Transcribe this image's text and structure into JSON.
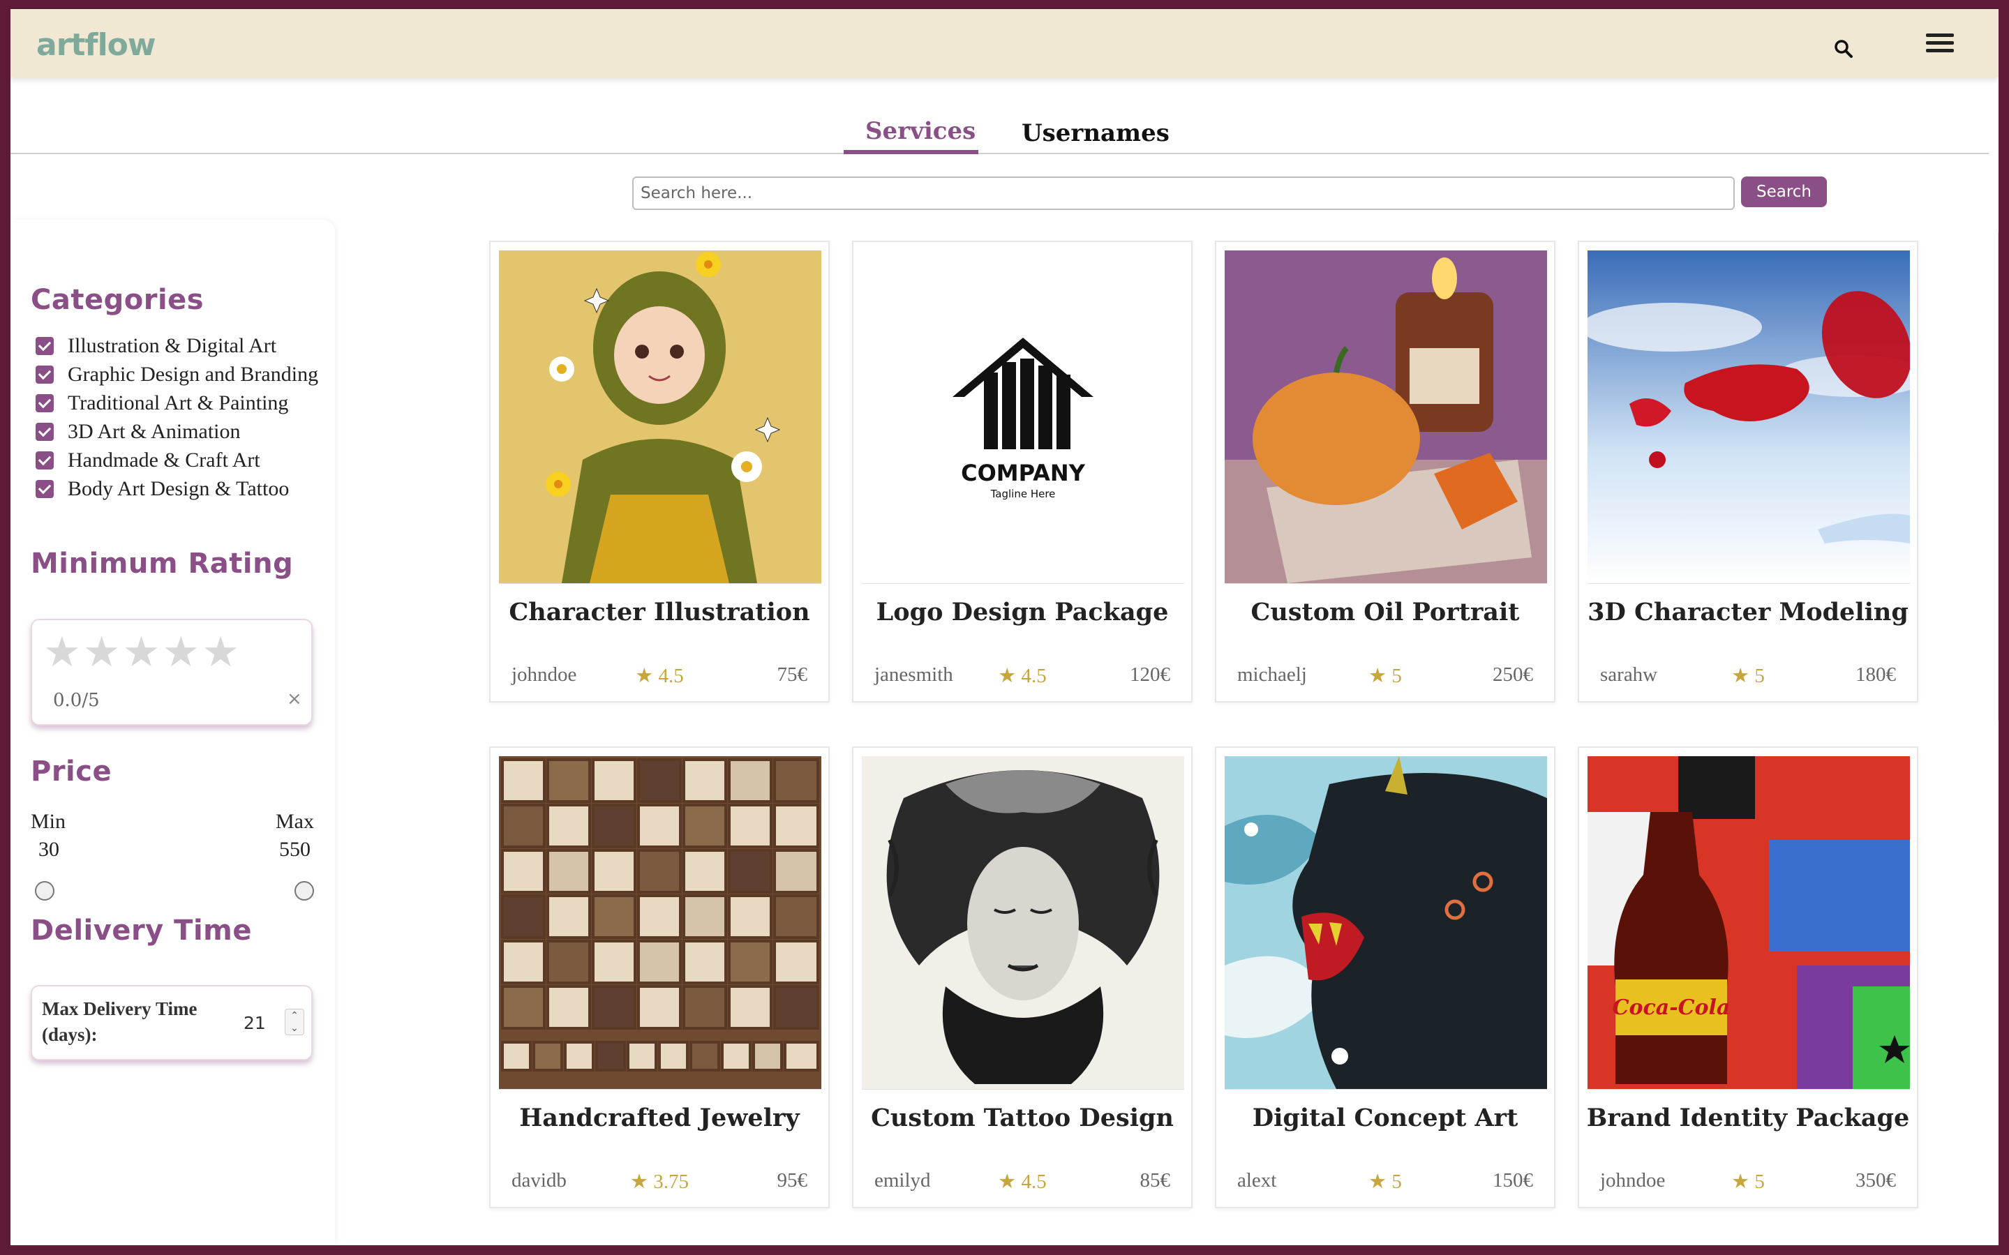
{
  "header": {
    "logo": "artflow",
    "search_icon": "search-icon",
    "menu_icon": "hamburger-menu-icon"
  },
  "tabs": [
    {
      "label": "Services",
      "active": true
    },
    {
      "label": "Usernames",
      "active": false
    }
  ],
  "search": {
    "placeholder": "Search here...",
    "button_label": "Search"
  },
  "sidebar": {
    "categories_title": "Categories",
    "categories": [
      {
        "label": "Illustration & Digital Art",
        "checked": true
      },
      {
        "label": "Graphic Design and Branding",
        "checked": true
      },
      {
        "label": "Traditional Art & Painting",
        "checked": true
      },
      {
        "label": "3D Art & Animation",
        "checked": true
      },
      {
        "label": "Handmade & Craft Art",
        "checked": true
      },
      {
        "label": "Body Art Design & Tattoo",
        "checked": true
      }
    ],
    "rating_title": "Minimum Rating",
    "rating": {
      "value_text": "0.0/5",
      "clear": "×",
      "stars": [
        "★",
        "★",
        "★",
        "★",
        "★"
      ]
    },
    "price_title": "Price",
    "price": {
      "min_label": "Min",
      "max_label": "Max",
      "min_value": "30",
      "max_value": "550"
    },
    "delivery_title": "Delivery Time",
    "delivery": {
      "label": "Max Delivery Time (days):",
      "value": "21",
      "spin_up": "⌃",
      "spin_down": "⌄"
    }
  },
  "services": [
    {
      "title": "Character Illustration",
      "user": "johndoe",
      "rating": "★ 4.5",
      "price": "75€",
      "image": "girl-illustration"
    },
    {
      "title": "Logo Design Package",
      "user": "janesmith",
      "rating": "★ 4.5",
      "price": "120€",
      "image": "company-logo",
      "logo_text": "COMPANY",
      "logo_tagline": "Tagline Here"
    },
    {
      "title": "Custom Oil Portrait",
      "user": "michaelj",
      "rating": "★ 5",
      "price": "250€",
      "image": "pumpkin-painting"
    },
    {
      "title": "3D Character Modeling",
      "user": "sarahw",
      "rating": "★ 5",
      "price": "180€",
      "image": "wine-glass-splash"
    },
    {
      "title": "Handcrafted Jewelry",
      "user": "davidb",
      "rating": "★ 3.75",
      "price": "95€",
      "image": "soap-blocks"
    },
    {
      "title": "Custom Tattoo Design",
      "user": "emilyd",
      "rating": "★ 4.5",
      "price": "85€",
      "image": "tattoo-face"
    },
    {
      "title": "Digital Concept Art",
      "user": "alext",
      "rating": "★ 5",
      "price": "150€",
      "image": "demon-concept"
    },
    {
      "title": "Brand Identity Package",
      "user": "johndoe",
      "rating": "★ 5",
      "price": "350€",
      "image": "cola-bottle-art",
      "bottle_text": "Coca-Cola"
    }
  ],
  "colors": {
    "frame": "#5e1b38",
    "header_bg": "#f0e8d2",
    "accent": "#8a4f86",
    "logo": "#7fa99b",
    "star_gold": "#c7a63e"
  }
}
